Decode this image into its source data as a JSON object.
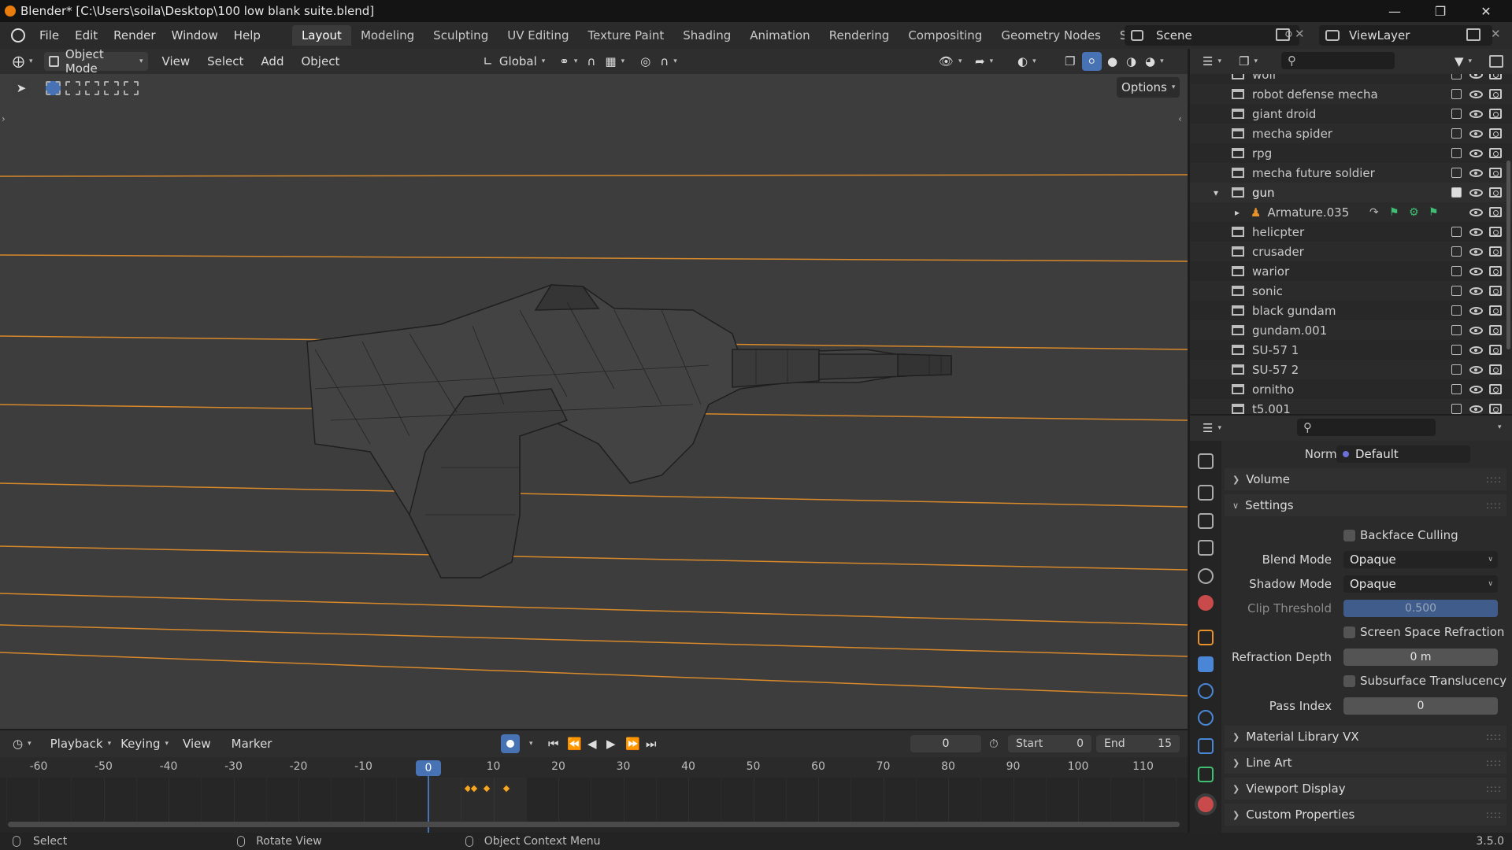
{
  "window": {
    "title": "Blender* [C:\\Users\\soila\\Desktop\\100 low blank suite.blend]",
    "controls": [
      "minimize",
      "maximize",
      "close"
    ]
  },
  "menu": [
    "File",
    "Edit",
    "Render",
    "Window",
    "Help"
  ],
  "workspaces": [
    "Layout",
    "Modeling",
    "Sculpting",
    "UV Editing",
    "Texture Paint",
    "Shading",
    "Animation",
    "Rendering",
    "Compositing",
    "Geometry Nodes",
    "Scripting"
  ],
  "active_workspace": "Layout",
  "scene": {
    "label": "Scene",
    "view_layer": "ViewLayer"
  },
  "viewport_header": {
    "mode": "Object Mode",
    "menus": [
      "View",
      "Select",
      "Add",
      "Object"
    ],
    "transform": "Global",
    "options": "Options"
  },
  "outliner": {
    "rows": [
      {
        "name": "wolf",
        "type": "collection",
        "checked": false
      },
      {
        "name": "robot defense mecha",
        "type": "collection",
        "checked": false
      },
      {
        "name": "giant droid",
        "type": "collection",
        "checked": false
      },
      {
        "name": "mecha spider",
        "type": "collection",
        "checked": false
      },
      {
        "name": "rpg",
        "type": "collection",
        "checked": false
      },
      {
        "name": "mecha future soldier",
        "type": "collection",
        "checked": false
      },
      {
        "name": "gun",
        "type": "collection",
        "checked": true,
        "expanded": true
      },
      {
        "name": "Armature.035",
        "type": "armature",
        "checked": false
      },
      {
        "name": "helicpter",
        "type": "collection",
        "checked": false
      },
      {
        "name": "crusader",
        "type": "collection",
        "checked": false
      },
      {
        "name": "warior",
        "type": "collection",
        "checked": false
      },
      {
        "name": "sonic",
        "type": "collection",
        "checked": false
      },
      {
        "name": "black gundam",
        "type": "collection",
        "checked": false
      },
      {
        "name": "gundam.001",
        "type": "collection",
        "checked": false
      },
      {
        "name": "SU-57 1",
        "type": "collection",
        "checked": false
      },
      {
        "name": "SU-57 2",
        "type": "collection",
        "checked": false
      },
      {
        "name": "ornitho",
        "type": "collection",
        "checked": false
      },
      {
        "name": "t5.001",
        "type": "collection",
        "checked": false
      }
    ]
  },
  "properties": {
    "normal_label": "Normal",
    "normal_value": "Default",
    "volume": "Volume",
    "settings": "Settings",
    "backface_culling": "Backface Culling",
    "blend_mode_label": "Blend Mode",
    "blend_mode": "Opaque",
    "shadow_mode_label": "Shadow Mode",
    "shadow_mode": "Opaque",
    "clip_threshold_label": "Clip Threshold",
    "clip_threshold": "0.500",
    "screen_space_refraction": "Screen Space Refraction",
    "refraction_depth_label": "Refraction Depth",
    "refraction_depth": "0 m",
    "subsurface_translucency": "Subsurface Translucency",
    "pass_index_label": "Pass Index",
    "pass_index": "0",
    "material_library": "Material Library VX",
    "line_art": "Line Art",
    "viewport_display": "Viewport Display",
    "custom_properties": "Custom Properties"
  },
  "timeline": {
    "menus": [
      "Playback",
      "Keying",
      "View",
      "Marker"
    ],
    "current_frame": "0",
    "start_label": "Start",
    "start": "0",
    "end_label": "End",
    "end": "15",
    "ruler": [
      "-60",
      "-50",
      "-40",
      "-30",
      "-20",
      "-10",
      "0",
      "10",
      "20",
      "30",
      "40",
      "50",
      "60",
      "70",
      "80",
      "90",
      "100",
      "110"
    ],
    "keyframes": [
      6,
      7,
      9,
      12
    ]
  },
  "status": {
    "select": "Select",
    "rotate": "Rotate View",
    "context": "Object Context Menu",
    "version": "3.5.0"
  },
  "colors": {
    "accent": "#4772b3",
    "keyframe": "#f5a623",
    "guide_line": "#d8892a"
  }
}
